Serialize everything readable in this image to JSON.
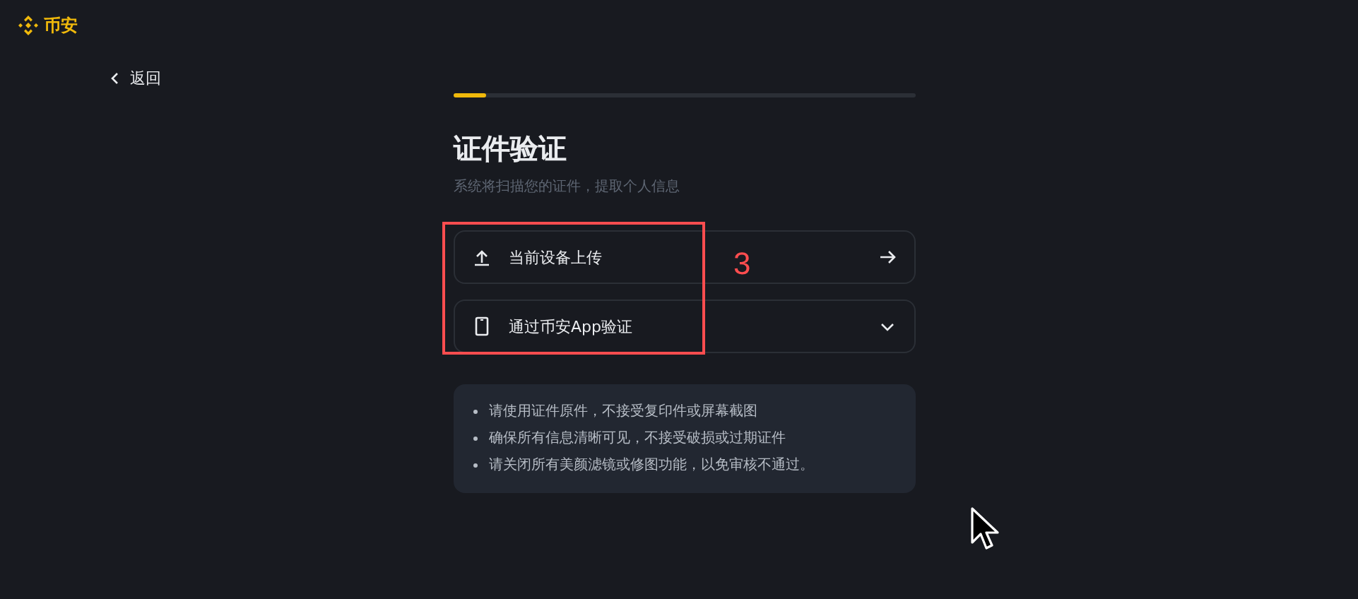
{
  "brand": {
    "name": "币安"
  },
  "back": {
    "label": "返回"
  },
  "progress": {
    "level": 0.07
  },
  "title": "证件验证",
  "subtitle": "系统将扫描您的证件，提取个人信息",
  "options": [
    {
      "kind": "upload",
      "label": "当前设备上传"
    },
    {
      "kind": "app",
      "label": "通过币安App验证"
    }
  ],
  "notes": [
    "请使用证件原件，不接受复印件或屏幕截图",
    "确保所有信息清晰可见，不接受破损或过期证件",
    "请关闭所有美颜滤镜或修图功能，以免审核不通过。"
  ],
  "annotation": {
    "label": "3"
  }
}
